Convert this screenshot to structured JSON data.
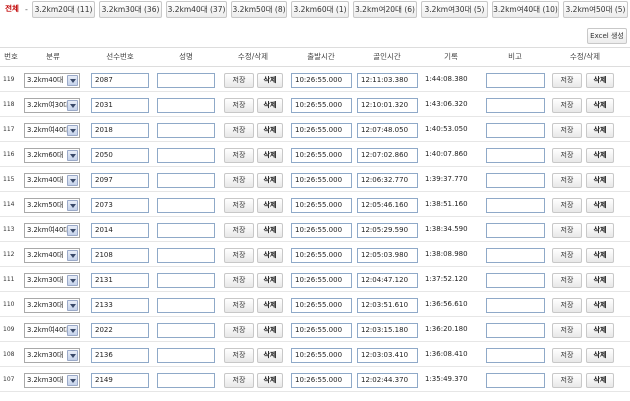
{
  "filters": [
    {
      "label": "전체",
      "active": true
    },
    {
      "label": "3.2km20대 (11)"
    },
    {
      "label": "3.2km30대 (36)"
    },
    {
      "label": "3.2km40대 (37)"
    },
    {
      "label": "3.2km50대 (8)"
    },
    {
      "label": "3.2km60대 (1)"
    },
    {
      "label": "3.2km여20대 (6)"
    },
    {
      "label": "3.2km여30대 (5)"
    },
    {
      "label": "3.2km여40대 (10)"
    },
    {
      "label": "3.2km여50대 (5)"
    }
  ],
  "filter_separator": "-",
  "excel_button": "Excel 생성",
  "headers": {
    "no": "번호",
    "category": "분류",
    "bib": "선수번호",
    "name": "성명",
    "edit_delete": "수정/삭제",
    "start_time": "출발시간",
    "goal_time": "골인시간",
    "record": "기록",
    "note": "비고",
    "edit_delete2": "수정/삭제"
  },
  "button_labels": {
    "save": "저장",
    "delete": "삭제"
  },
  "rows": [
    {
      "no": "119",
      "category": "3.2km40대",
      "bib": "2087",
      "name": "",
      "start": "10:26:55.000",
      "goal": "12:11:03.380",
      "record": "1:44:08.380",
      "note": ""
    },
    {
      "no": "118",
      "category": "3.2km여30대",
      "bib": "2031",
      "name": "",
      "start": "10:26:55.000",
      "goal": "12:10:01.320",
      "record": "1:43:06.320",
      "note": ""
    },
    {
      "no": "117",
      "category": "3.2km여40대",
      "bib": "2018",
      "name": "",
      "start": "10:26:55.000",
      "goal": "12:07:48.050",
      "record": "1:40:53.050",
      "note": ""
    },
    {
      "no": "116",
      "category": "3.2km60대",
      "bib": "2050",
      "name": "",
      "start": "10:26:55.000",
      "goal": "12:07:02.860",
      "record": "1:40:07.860",
      "note": ""
    },
    {
      "no": "115",
      "category": "3.2km40대",
      "bib": "2097",
      "name": "",
      "start": "10:26:55.000",
      "goal": "12:06:32.770",
      "record": "1:39:37.770",
      "note": ""
    },
    {
      "no": "114",
      "category": "3.2km50대",
      "bib": "2073",
      "name": "",
      "start": "10:26:55.000",
      "goal": "12:05:46.160",
      "record": "1:38:51.160",
      "note": ""
    },
    {
      "no": "113",
      "category": "3.2km여40대",
      "bib": "2014",
      "name": "",
      "start": "10:26:55.000",
      "goal": "12:05:29.590",
      "record": "1:38:34.590",
      "note": ""
    },
    {
      "no": "112",
      "category": "3.2km40대",
      "bib": "2108",
      "name": "",
      "start": "10:26:55.000",
      "goal": "12:05:03.980",
      "record": "1:38:08.980",
      "note": ""
    },
    {
      "no": "111",
      "category": "3.2km30대",
      "bib": "2131",
      "name": "",
      "start": "10:26:55.000",
      "goal": "12:04:47.120",
      "record": "1:37:52.120",
      "note": ""
    },
    {
      "no": "110",
      "category": "3.2km30대",
      "bib": "2133",
      "name": "",
      "start": "10:26:55.000",
      "goal": "12:03:51.610",
      "record": "1:36:56.610",
      "note": ""
    },
    {
      "no": "109",
      "category": "3.2km여40대",
      "bib": "2022",
      "name": "",
      "start": "10:26:55.000",
      "goal": "12:03:15.180",
      "record": "1:36:20.180",
      "note": ""
    },
    {
      "no": "108",
      "category": "3.2km30대",
      "bib": "2136",
      "name": "",
      "start": "10:26:55.000",
      "goal": "12:03:03.410",
      "record": "1:36:08.410",
      "note": ""
    },
    {
      "no": "107",
      "category": "3.2km30대",
      "bib": "2149",
      "name": "",
      "start": "10:26:55.000",
      "goal": "12:02:44.370",
      "record": "1:35:49.370",
      "note": ""
    }
  ]
}
